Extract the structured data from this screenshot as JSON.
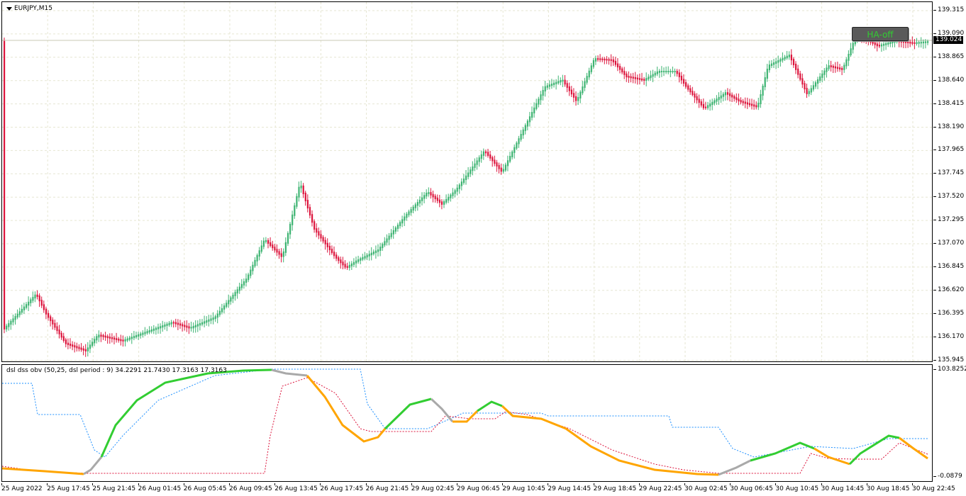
{
  "chart": {
    "symbol_title": "EURJPY,M15",
    "current_price": "139.024",
    "price_labels": [
      "139.315",
      "139.090",
      "138.865",
      "138.640",
      "138.415",
      "138.190",
      "137.965",
      "137.745",
      "137.520",
      "137.295",
      "137.070",
      "136.845",
      "136.620",
      "136.395",
      "136.170",
      "135.945"
    ],
    "ha_button_label": "HA-off",
    "colors": {
      "bull": "#3cb371",
      "bear": "#dc143c",
      "grid": "#e6e6d2"
    }
  },
  "indicator": {
    "title": "dsl dss obv (50,25, dsl period : 9) 34.2291 21.7430 17.3163 17.3163",
    "scale_top": "103.8252",
    "scale_bottom": "-0.0879",
    "colors": {
      "up": "#32cd32",
      "down": "#ffa500",
      "neutral": "#a9a9a9",
      "dsl_up": "#1e90ff",
      "dsl_down": "#dc143c"
    }
  },
  "time_axis": [
    "25 Aug 2022",
    "25 Aug 17:45",
    "25 Aug 21:45",
    "26 Aug 01:45",
    "26 Aug 05:45",
    "26 Aug 09:45",
    "26 Aug 13:45",
    "26 Aug 17:45",
    "26 Aug 21:45",
    "29 Aug 02:45",
    "29 Aug 06:45",
    "29 Aug 10:45",
    "29 Aug 14:45",
    "29 Aug 18:45",
    "29 Aug 22:45",
    "30 Aug 02:45",
    "30 Aug 06:45",
    "30 Aug 10:45",
    "30 Aug 14:45",
    "30 Aug 18:45",
    "30 Aug 22:45"
  ]
}
